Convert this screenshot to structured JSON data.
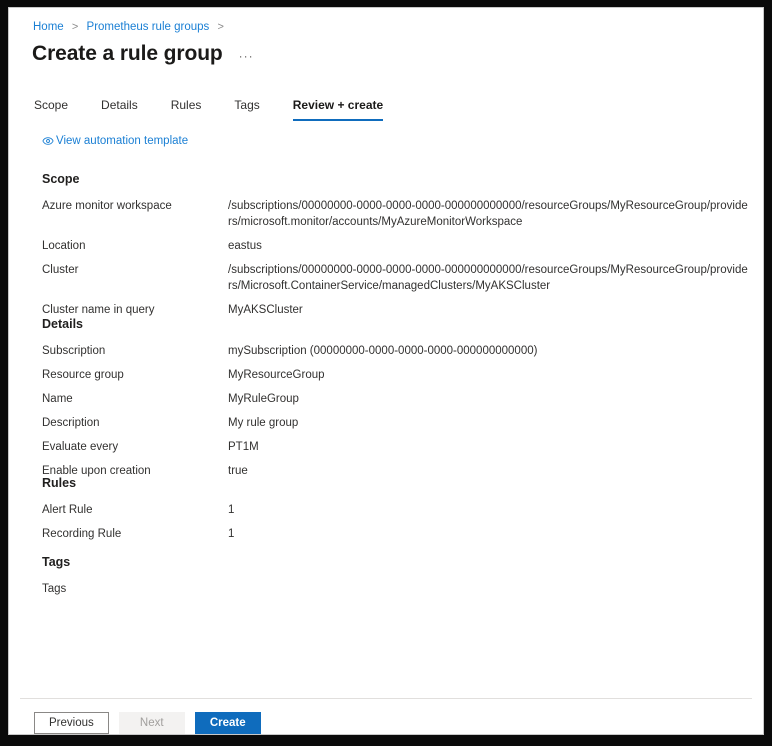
{
  "breadcrumb": {
    "items": [
      {
        "label": "Home"
      },
      {
        "label": "Prometheus rule groups"
      }
    ],
    "separator": ">"
  },
  "header": {
    "title": "Create a rule group",
    "more_label": "···"
  },
  "tabs": [
    {
      "label": "Scope",
      "active": false
    },
    {
      "label": "Details",
      "active": false
    },
    {
      "label": "Rules",
      "active": false
    },
    {
      "label": "Tags",
      "active": false
    },
    {
      "label": "Review + create",
      "active": true
    }
  ],
  "automation_link": {
    "label": "View automation template",
    "icon": "eye-icon"
  },
  "sections": [
    {
      "id": "scope",
      "title": "Scope",
      "rows": [
        {
          "label": "Azure monitor workspace",
          "value": "/subscriptions/00000000-0000-0000-0000-000000000000/resourceGroups/MyResourceGroup/providers/microsoft.monitor/accounts/MyAzureMonitorWorkspace"
        },
        {
          "label": "Location",
          "value": "eastus"
        },
        {
          "label": "Cluster",
          "value": "/subscriptions/00000000-0000-0000-0000-000000000000/resourceGroups/MyResourceGroup/providers/Microsoft.ContainerService/managedClusters/MyAKSCluster"
        },
        {
          "label": "Cluster name in query",
          "value": "MyAKSCluster"
        }
      ]
    },
    {
      "id": "details",
      "title": "Details",
      "rows": [
        {
          "label": "Subscription",
          "value": "mySubscription (00000000-0000-0000-0000-000000000000)"
        },
        {
          "label": "Resource group",
          "value": "MyResourceGroup"
        },
        {
          "label": "Name",
          "value": "MyRuleGroup"
        },
        {
          "label": "Description",
          "value": "My rule group"
        },
        {
          "label": "Evaluate every",
          "value": "PT1M"
        },
        {
          "label": "Enable upon creation",
          "value": "true"
        }
      ]
    },
    {
      "id": "rules",
      "title": "Rules",
      "rows": [
        {
          "label": "Alert Rule",
          "value": "1"
        },
        {
          "label": "Recording Rule",
          "value": "1"
        }
      ]
    },
    {
      "id": "tags",
      "title": "Tags",
      "rows": [
        {
          "label": "Tags",
          "value": ""
        }
      ]
    }
  ],
  "footer": {
    "previous_label": "Previous",
    "next_label": "Next",
    "create_label": "Create"
  },
  "colors": {
    "accent": "#0f6cbd",
    "link": "#1a7fd4",
    "text": "#323130",
    "heading": "#201f1e",
    "disabled_bg": "#f3f2f1",
    "disabled_text": "#a19f9d",
    "divider": "#e1dfdd",
    "frame": "#0a0a0a"
  }
}
